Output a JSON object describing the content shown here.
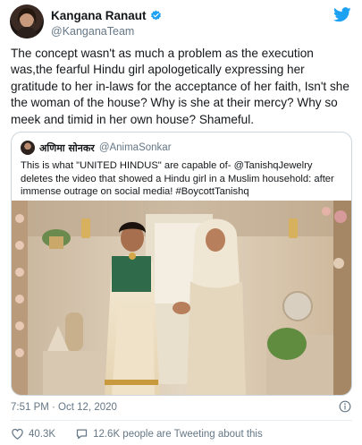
{
  "author": {
    "display_name": "Kangana Ranaut",
    "handle": "@KanganaTeam",
    "verified_color": "#1da1f2"
  },
  "brand": {
    "logo_icon": "twitter-bird-icon",
    "color": "#1da1f2"
  },
  "tweet": {
    "text": "The concept wasn't as much a problem as the execution was,the fearful Hindu girl apologetically expressing her gratitude to her in-laws for the acceptance of her faith, Isn't she the woman of the house? Why is she at their mercy? Why so meek and timid in her own house? Shameful."
  },
  "quoted_tweet": {
    "display_name": "अणिमा सोनकर",
    "handle": "@AnimaSonkar",
    "text": "This is what \"UNITED HINDUS\" are capable of- @TanishqJewelry deletes the video that showed a Hindu girl in a Muslim household: after immense outrage on social media! #BoycottTanishq"
  },
  "meta": {
    "timestamp": "7:51 PM · Oct 12, 2020"
  },
  "actions": {
    "likes": "40.3K",
    "comments": "12.6K people are Tweeting about this"
  }
}
